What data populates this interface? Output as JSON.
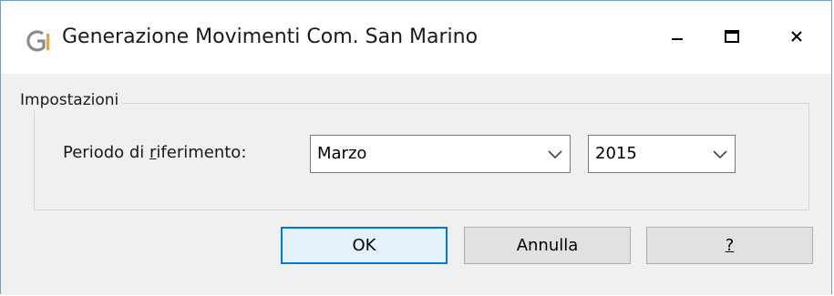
{
  "window": {
    "title": "Generazione Movimenti Com. San Marino",
    "logo_icon": "g-brand-logo-icon",
    "controls": {
      "minimize_icon": "minimize-icon",
      "maximize_icon": "maximize-icon",
      "close_icon": "close-icon"
    },
    "accent_color": "#0078d7",
    "logo_colors": [
      "#8c8c8c",
      "#e8a33d"
    ]
  },
  "settings_group": {
    "legend": "Impostazioni",
    "period": {
      "label_prefix": "Periodo di ",
      "label_accel": "r",
      "label_suffix": "iferimento:",
      "month": {
        "value": "Marzo",
        "icon": "chevron-down-icon"
      },
      "year": {
        "value": "2015",
        "icon": "chevron-down-icon"
      }
    }
  },
  "buttons": {
    "ok": "OK",
    "cancel": "Annulla",
    "help": "?"
  }
}
